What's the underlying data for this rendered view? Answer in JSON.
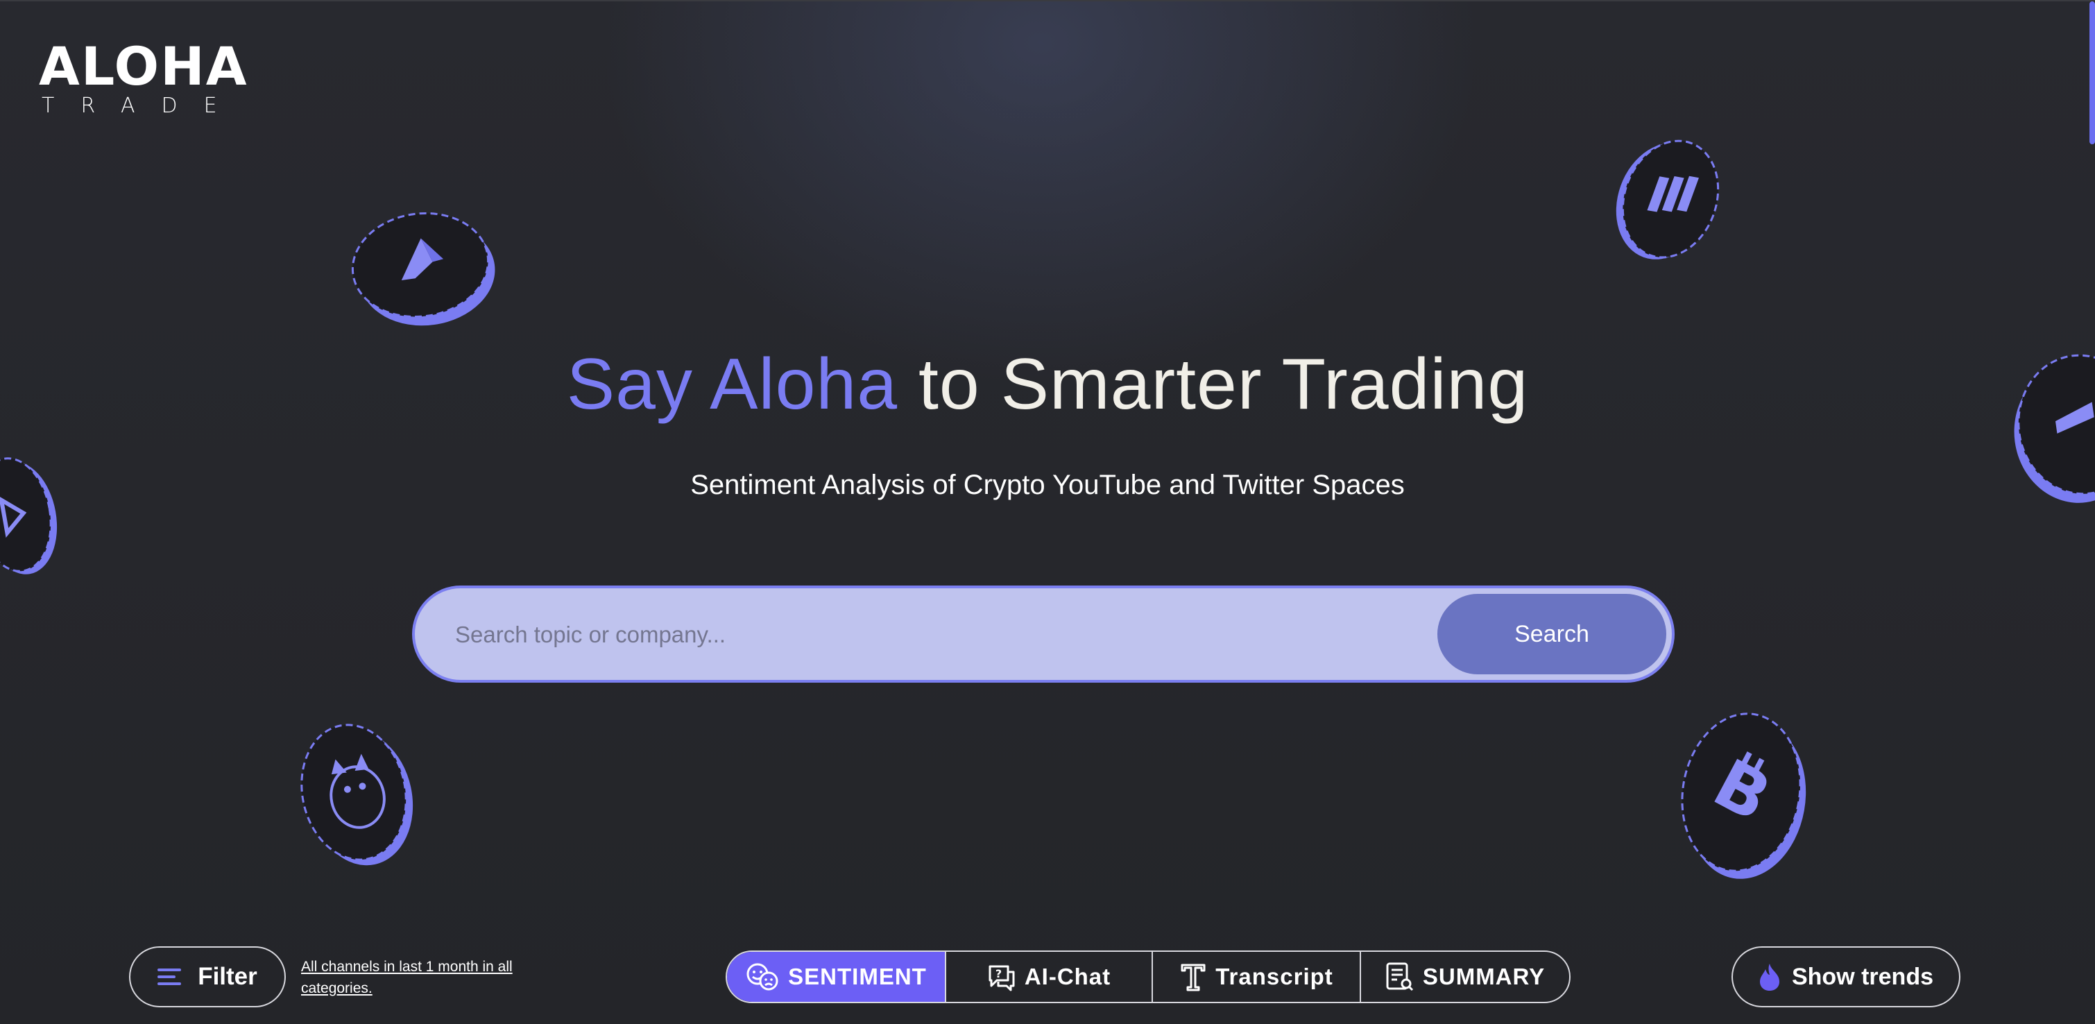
{
  "logo": {
    "main": "ALOHA",
    "sub": "TRADE"
  },
  "hero": {
    "headline_accent": "Say Aloha",
    "headline_rest": " to Smarter Trading",
    "subheadline": "Sentiment Analysis of Crypto YouTube and Twitter Spaces"
  },
  "search": {
    "placeholder": "Search topic or company...",
    "value": "",
    "button_label": "Search"
  },
  "filter": {
    "label": "Filter",
    "note": "All channels in last 1 month in all categories."
  },
  "modes": [
    {
      "label": "SENTIMENT",
      "icon": "sentiment-faces-icon",
      "active": true
    },
    {
      "label": "AI-Chat",
      "icon": "chat-question-icon",
      "active": false
    },
    {
      "label": "Transcript",
      "icon": "text-t-icon",
      "active": false
    },
    {
      "label": "SUMMARY",
      "icon": "document-search-icon",
      "active": false
    }
  ],
  "trends": {
    "label": "Show trends",
    "icon": "flame-icon"
  },
  "coins": [
    "ethereum-coin",
    "solana-coin",
    "dogecoin-coin",
    "bitcoin-coin",
    "tron-coin",
    "partial-coin-right"
  ],
  "colors": {
    "accent": "#7a7cf2",
    "active_tab": "#6c5ff5",
    "search_bg": "#bfc3ee",
    "search_button": "#6a74c2",
    "background": "#25262b"
  }
}
